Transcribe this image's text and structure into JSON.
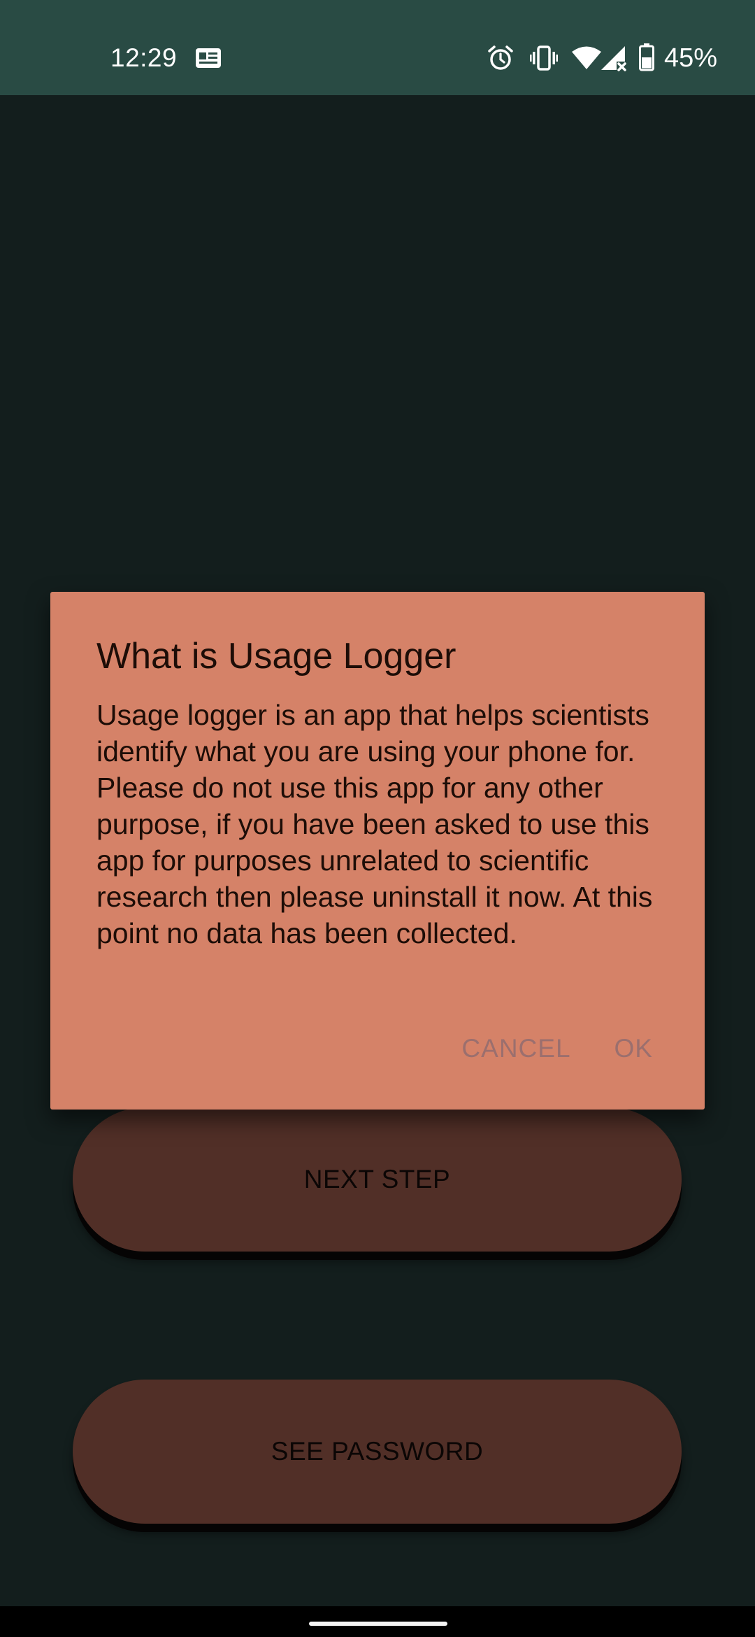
{
  "status_bar": {
    "time": "12:29",
    "battery_percent": "45%",
    "icons": [
      "news-icon",
      "alarm-icon",
      "vibrate-icon",
      "wifi-icon",
      "cellular-no-service-icon",
      "battery-icon"
    ]
  },
  "dialog": {
    "title": "What is Usage Logger",
    "message": "Usage logger is an app that helps scientists identify what you are using your phone for. Please do not use this app for any other purpose, if you have been asked to use this app for purposes unrelated to scientific research then please uninstall it now. At this point no data has been collected.",
    "cancel_label": "CANCEL",
    "ok_label": "OK"
  },
  "buttons": {
    "next_step": "NEXT STEP",
    "see_password": "SEE PASSWORD"
  },
  "colors": {
    "status_bar": "#294b44",
    "background": "#131e1d",
    "dialog": "#d58268",
    "dialog_text": "#1d0d07",
    "dialog_actions": "#9b6f6e",
    "button": "#512f27",
    "button_text": "#0b0605"
  }
}
